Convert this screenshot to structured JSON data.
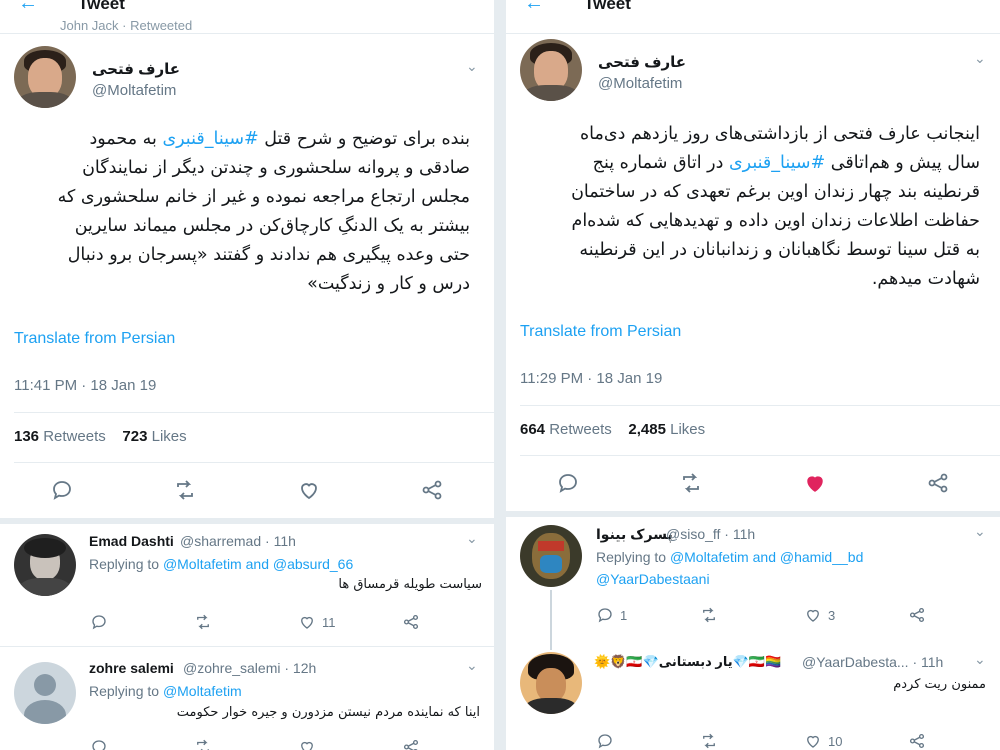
{
  "common": {
    "header_title": "Tweet",
    "translate_label": "Translate from Persian",
    "retweets_label": "Retweets",
    "likes_label": "Likes",
    "replying_to_label": "Replying to",
    "and_label": "and",
    "heart_color": "#e0245e",
    "link_color": "#1da1f2"
  },
  "left": {
    "retweeted_by": "John Jack · Retweeted",
    "author_name": "عارف فتحی",
    "author_handle": "@Moltafetim",
    "tweet_line1_a": "بنده برای توضیح و شرح قتل ",
    "tweet_line1_hashtag": "#سینا_قنبری",
    "tweet_line1_b": " به محمود",
    "tweet_line2": "صادقی و پروانه سلحشوری و چندتن دیگر از نمایندگان",
    "tweet_line3": "مجلس ارتجاع مراجعه نموده و غیر از خانم سلحشوری که",
    "tweet_line4": "بیشتر به یک الدنگِ کارچاق‌کن در مجلس میماند سایرین",
    "tweet_line5": "حتی وعده پیگیری هم ندادند و گفتند «پسرجان برو دنبال",
    "tweet_line6": "درس و کار و زندگیت»",
    "time": "11:41 PM · 18 Jan 19",
    "retweets": "136",
    "likes": "723",
    "replies": [
      {
        "name": "Emad Dashti",
        "handle": "@sharremad · 11h",
        "mention1": "@Moltafetim",
        "mention2": "@absurd_66",
        "text": "سیاست طویله قرمساق ها",
        "like_count": "11"
      },
      {
        "name": "zohre salemi",
        "handle": "@zohre_salemi · 12h",
        "mention1": "@Moltafetim",
        "text": "اینا که نماینده مردم نیستن مزدورن و جیره خوار حکومت"
      }
    ]
  },
  "right": {
    "author_name": "عارف فتحی",
    "author_handle": "@Moltafetim",
    "tweet_line1": "اینجانب عارف فتحی از بازداشتی‌های روز یازدهم دی‌ماه",
    "tweet_line2_a": "سال پیش و هم‌اتاقی ",
    "tweet_line2_hashtag": "#سینا_قنبری",
    "tweet_line2_b": " در اتاق شماره پنج",
    "tweet_line3": "قرنطینه بند چهار زندان اوین برغم تعهدی که در ساختمان",
    "tweet_line4": "حفاظت اطلاعات زندان اوین داده و تهدیدهایی که شده‌ام",
    "tweet_line5": "به قتل سینا توسط نگاهبانان و زندانبانان در این قرنطینه",
    "tweet_line6": "شهادت میدهم.",
    "time": "11:29 PM · 18 Jan 19",
    "retweets": "664",
    "likes": "2,485",
    "replies": [
      {
        "name": "پسرک بینوا",
        "handle": "@siso_ff · 11h",
        "mention1": "@Moltafetim",
        "mention2": "@hamid__bd",
        "mention3": "@YaarDabestaani",
        "reply_count": "1",
        "like_count": "3"
      },
      {
        "name": "🌞🦁🇮🇷💎یار دبستانی💎🇮🇷🏳️‍🌈",
        "handle": "@YaarDabesta... · 11h",
        "text": "ممنون ریت کردم",
        "like_count": "10"
      }
    ]
  }
}
